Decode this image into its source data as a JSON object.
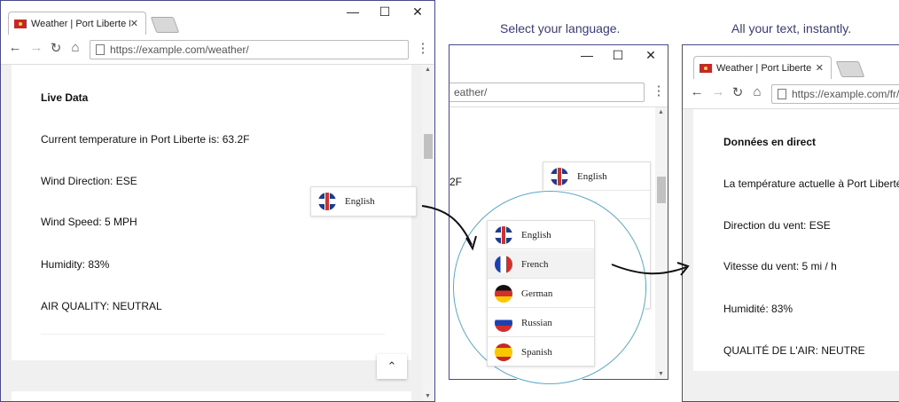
{
  "browser": {
    "tab_title": "Weather | Port Liberte Life",
    "tab_close": "✕",
    "url": "https://example.com/weather/",
    "url_fr": "https://example.com/fr/weather/",
    "url_partial": "eather/",
    "minimize": "—",
    "maximize": "☐",
    "close": "✕",
    "back_icon": "←",
    "forward_icon": "→",
    "reload_icon": "↻",
    "home_icon": "⌂",
    "menu_icon": "⋮"
  },
  "captions": {
    "select_language": "Select your language.",
    "instant": "All your text, instantly."
  },
  "page_en": {
    "heading": "Live Data",
    "temperature": "Current temperature in Port Liberte is: 63.2F",
    "wind_direction": "Wind Direction: ESE",
    "wind_speed": "Wind Speed: 5 MPH",
    "humidity": "Humidity: 83%",
    "air_quality": "AIR QUALITY: NEUTRAL",
    "partial_temp": "2F"
  },
  "page_fr": {
    "heading": "Données en direct",
    "temperature": "La température actuelle à Port Liberté est",
    "wind_direction": "Direction du vent: ESE",
    "wind_speed": "Vitesse du vent: 5 mi / h",
    "humidity": "Humidité: 83%",
    "air_quality": "QUALITÉ DE L'AIR: NEUTRE"
  },
  "language_selector": {
    "current": "English",
    "options": [
      "English",
      "French",
      "German",
      "Russian",
      "Spanish"
    ],
    "selected": "French",
    "partial_second": "h"
  },
  "scroll_top_icon": "⌃",
  "colors": {
    "accent": "#4a4a8a",
    "circle": "#5aa9c8",
    "caption": "#3a3a7a"
  }
}
